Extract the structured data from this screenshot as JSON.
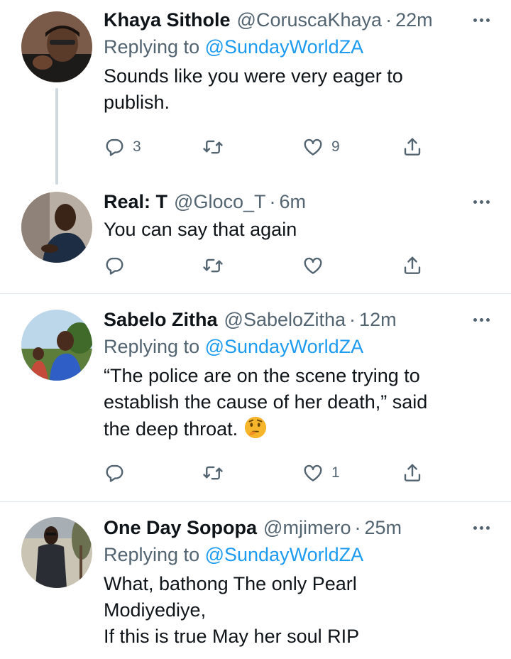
{
  "tweets": [
    {
      "name": "Khaya Sithole",
      "handle": "@CoruscaKhaya",
      "separator": "·",
      "time": "22m",
      "replying_prefix": "Replying to ",
      "replying_to": "@SundayWorldZA",
      "text": "Sounds like you were very eager to\npublish.",
      "replies": "3",
      "retweets": "",
      "likes": "9"
    },
    {
      "name": "Real: T",
      "handle": "@Gloco_T",
      "separator": "·",
      "time": "6m",
      "replying_prefix": "",
      "replying_to": "",
      "text": "You can say that again",
      "replies": "",
      "retweets": "",
      "likes": ""
    },
    {
      "name": "Sabelo Zitha",
      "handle": "@SabeloZitha",
      "separator": "·",
      "time": "12m",
      "replying_prefix": "Replying to ",
      "replying_to": "@SundayWorldZA",
      "text": "“The police are on the scene trying to\nestablish the cause of her death,” said\nthe deep throat.",
      "emoji": "thinking-face",
      "replies": "",
      "retweets": "",
      "likes": "1"
    },
    {
      "name": "One Day Sopopa",
      "handle": "@mjimero",
      "separator": "·",
      "time": "25m",
      "replying_prefix": "Replying to ",
      "replying_to": "@SundayWorldZA",
      "text": "What, bathong The only Pearl\nModiyediye,\nIf this is true May her soul RIP"
    }
  ],
  "icons": {
    "reply": "reply-icon",
    "retweet": "retweet-icon",
    "like": "heart-icon",
    "share": "share-icon",
    "more": "more-icon"
  },
  "colors": {
    "text": "#0f1419",
    "secondary": "#536471",
    "link": "#1d9bf0",
    "divider": "#e1e8ed",
    "thread_line": "#cfd9de"
  }
}
